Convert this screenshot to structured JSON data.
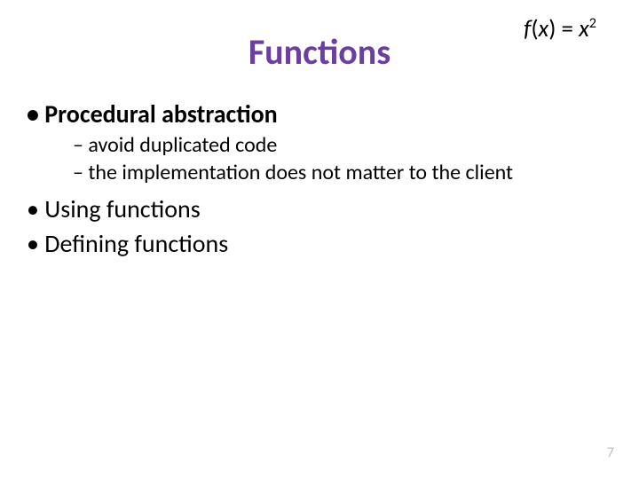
{
  "title": "Functions",
  "formula": {
    "fn": "f",
    "arg": "x",
    "eq": " = ",
    "base": "x",
    "exp": "2"
  },
  "bullets": {
    "b1": "Procedural abstraction",
    "b1_sub1": "avoid duplicated code",
    "b1_sub2": "the implementation does not matter to the client",
    "b2": "Using functions",
    "b3": "Defining functions"
  },
  "page_number": "7"
}
